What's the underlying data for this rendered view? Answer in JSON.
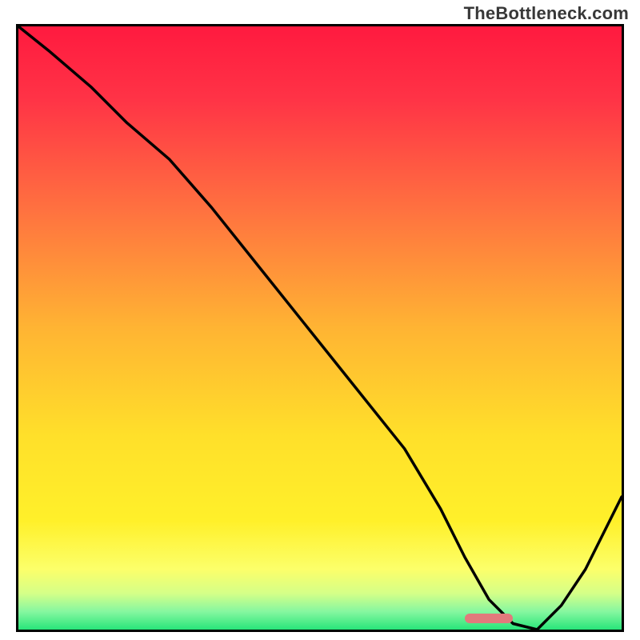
{
  "watermark": "TheBottleneck.com",
  "colors": {
    "frame": "#000000",
    "curve": "#000000",
    "marker": "#e2797c",
    "gradient_stops": [
      {
        "offset": 0.0,
        "color": "#ff1a3f"
      },
      {
        "offset": 0.12,
        "color": "#ff3346"
      },
      {
        "offset": 0.3,
        "color": "#ff7040"
      },
      {
        "offset": 0.5,
        "color": "#ffb433"
      },
      {
        "offset": 0.68,
        "color": "#ffe02a"
      },
      {
        "offset": 0.82,
        "color": "#fff02a"
      },
      {
        "offset": 0.9,
        "color": "#fcff6a"
      },
      {
        "offset": 0.94,
        "color": "#d5ff88"
      },
      {
        "offset": 0.97,
        "color": "#86f7a0"
      },
      {
        "offset": 1.0,
        "color": "#28e57a"
      }
    ]
  },
  "chart_data": {
    "type": "line",
    "title": "",
    "xlabel": "",
    "ylabel": "",
    "xlim": [
      0,
      100
    ],
    "ylim": [
      0,
      100
    ],
    "grid": false,
    "series": [
      {
        "name": "curve",
        "color": "#000000",
        "x": [
          0,
          5,
          12,
          18,
          25,
          32,
          40,
          48,
          56,
          64,
          70,
          74,
          78,
          82,
          86,
          90,
          94,
          100
        ],
        "y": [
          100,
          96,
          90,
          84,
          78,
          70,
          60,
          50,
          40,
          30,
          20,
          12,
          5,
          1,
          0,
          4,
          10,
          22
        ]
      }
    ],
    "marker": {
      "x_start": 74,
      "x_end": 82,
      "y": 0.5
    },
    "legend": false
  }
}
